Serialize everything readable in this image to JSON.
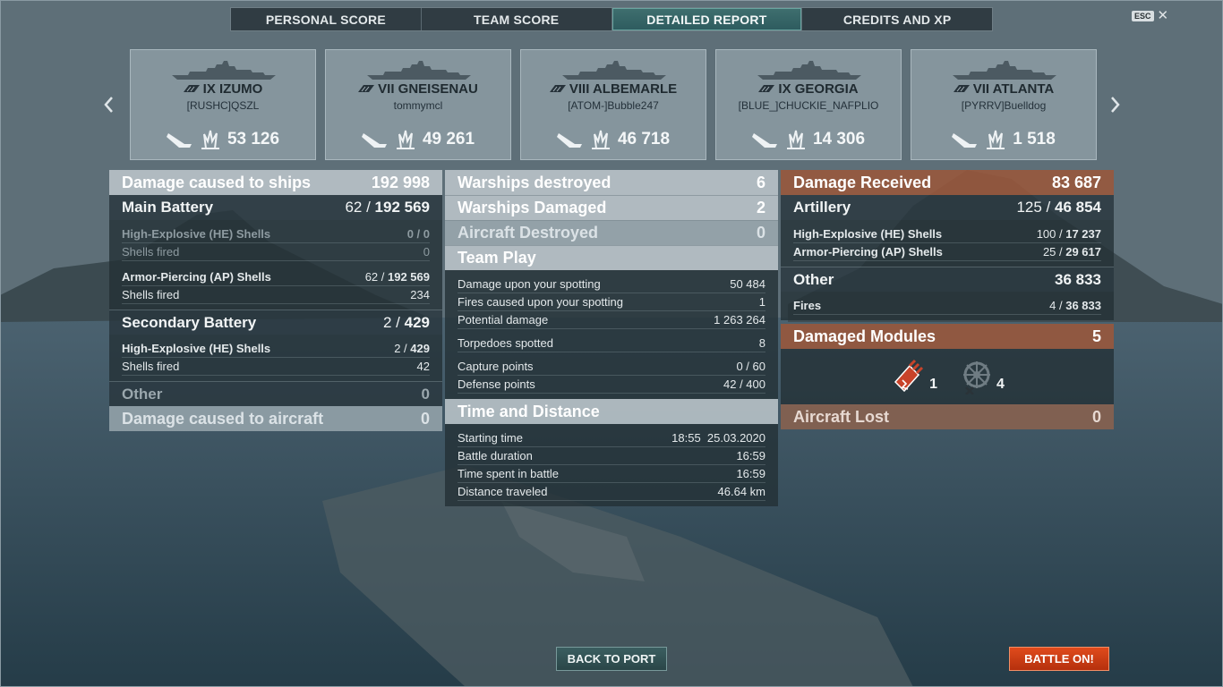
{
  "tabs": [
    {
      "label": "PERSONAL SCORE"
    },
    {
      "label": "TEAM SCORE"
    },
    {
      "label": "DETAILED REPORT",
      "active": true
    },
    {
      "label": "CREDITS AND XP"
    }
  ],
  "esc": {
    "key": "ESC",
    "close": "✕"
  },
  "ships": [
    {
      "tier_name": "IX IZUMO",
      "player": "[RUSHC]QSZL",
      "damage": "53 126"
    },
    {
      "tier_name": "VII GNEISENAU",
      "player": "tommymcl",
      "damage": "49 261"
    },
    {
      "tier_name": "VIII ALBEMARLE",
      "player": "[ATOM-]Bubble247",
      "damage": "46 718"
    },
    {
      "tier_name": "IX GEORGIA",
      "player": "[BLUE_]CHUCKIE_NAFPLIO",
      "damage": "14 306"
    },
    {
      "tier_name": "VII ATLANTA",
      "player": "[PYRRV]Buelldog",
      "damage": "1 518"
    }
  ],
  "left": {
    "damage_ships": {
      "label": "Damage caused to ships",
      "value": "192 998"
    },
    "main_battery": {
      "label": "Main Battery",
      "hits": "62",
      "value": "192 569"
    },
    "mb_he": {
      "label": "High-Explosive (HE) Shells",
      "value": "0 / 0"
    },
    "mb_he_fired": {
      "label": "Shells fired",
      "value": "0"
    },
    "mb_ap": {
      "label": "Armor-Piercing (AP) Shells",
      "hits": "62 / ",
      "value": "192 569"
    },
    "mb_ap_fired": {
      "label": "Shells fired",
      "value": "234"
    },
    "secondary": {
      "label": "Secondary Battery",
      "hits": "2",
      "value": "429"
    },
    "sec_he": {
      "label": "High-Explosive (HE) Shells",
      "hits": "2 / ",
      "value": "429"
    },
    "sec_he_fired": {
      "label": "Shells fired",
      "value": "42"
    },
    "other": {
      "label": "Other",
      "value": "0"
    },
    "damage_aircraft": {
      "label": "Damage caused to aircraft",
      "value": "0"
    }
  },
  "middle": {
    "destroyed": {
      "label": "Warships destroyed",
      "value": "6"
    },
    "damaged": {
      "label": "Warships Damaged",
      "value": "2"
    },
    "aircraft": {
      "label": "Aircraft Destroyed",
      "value": "0"
    },
    "team_play": {
      "label": "Team Play"
    },
    "tp_rows": [
      {
        "label": "Damage upon your spotting",
        "value": "50 484"
      },
      {
        "label": "Fires caused upon your spotting",
        "value": "1"
      },
      {
        "label": "Potential damage",
        "value": "1 263 264"
      },
      {
        "label": "Torpedoes spotted",
        "value": "8"
      },
      {
        "label": "Capture points",
        "value": "0 / 60"
      },
      {
        "label": "Defense points",
        "value": "42 / 400"
      }
    ],
    "time": {
      "label": "Time and Distance"
    },
    "time_rows": [
      {
        "label": "Starting time",
        "value": "18:55  25.03.2020"
      },
      {
        "label": "Battle duration",
        "value": "16:59"
      },
      {
        "label": "Time spent in battle",
        "value": "16:59"
      },
      {
        "label": "Distance traveled",
        "value": "46.64 km"
      }
    ]
  },
  "right": {
    "received": {
      "label": "Damage Received",
      "value": "83 687"
    },
    "artillery": {
      "label": "Artillery",
      "hits": "125",
      "value": "46 854"
    },
    "art_he": {
      "label": "High-Explosive (HE) Shells",
      "hits": "100 / ",
      "value": "17 237"
    },
    "art_ap": {
      "label": "Armor-Piercing (AP) Shells",
      "hits": "25 / ",
      "value": "29 617"
    },
    "other": {
      "label": "Other",
      "value": "36 833"
    },
    "fires": {
      "label": "Fires",
      "hits": "4 / ",
      "value": "36 833"
    },
    "modules": {
      "label": "Damaged Modules",
      "value": "5",
      "engine": "1",
      "steering": "4"
    },
    "aircraft_lost": {
      "label": "Aircraft Lost",
      "value": "0"
    }
  },
  "buttons": {
    "back": "BACK TO PORT",
    "battle": "BATTLE ON!"
  }
}
